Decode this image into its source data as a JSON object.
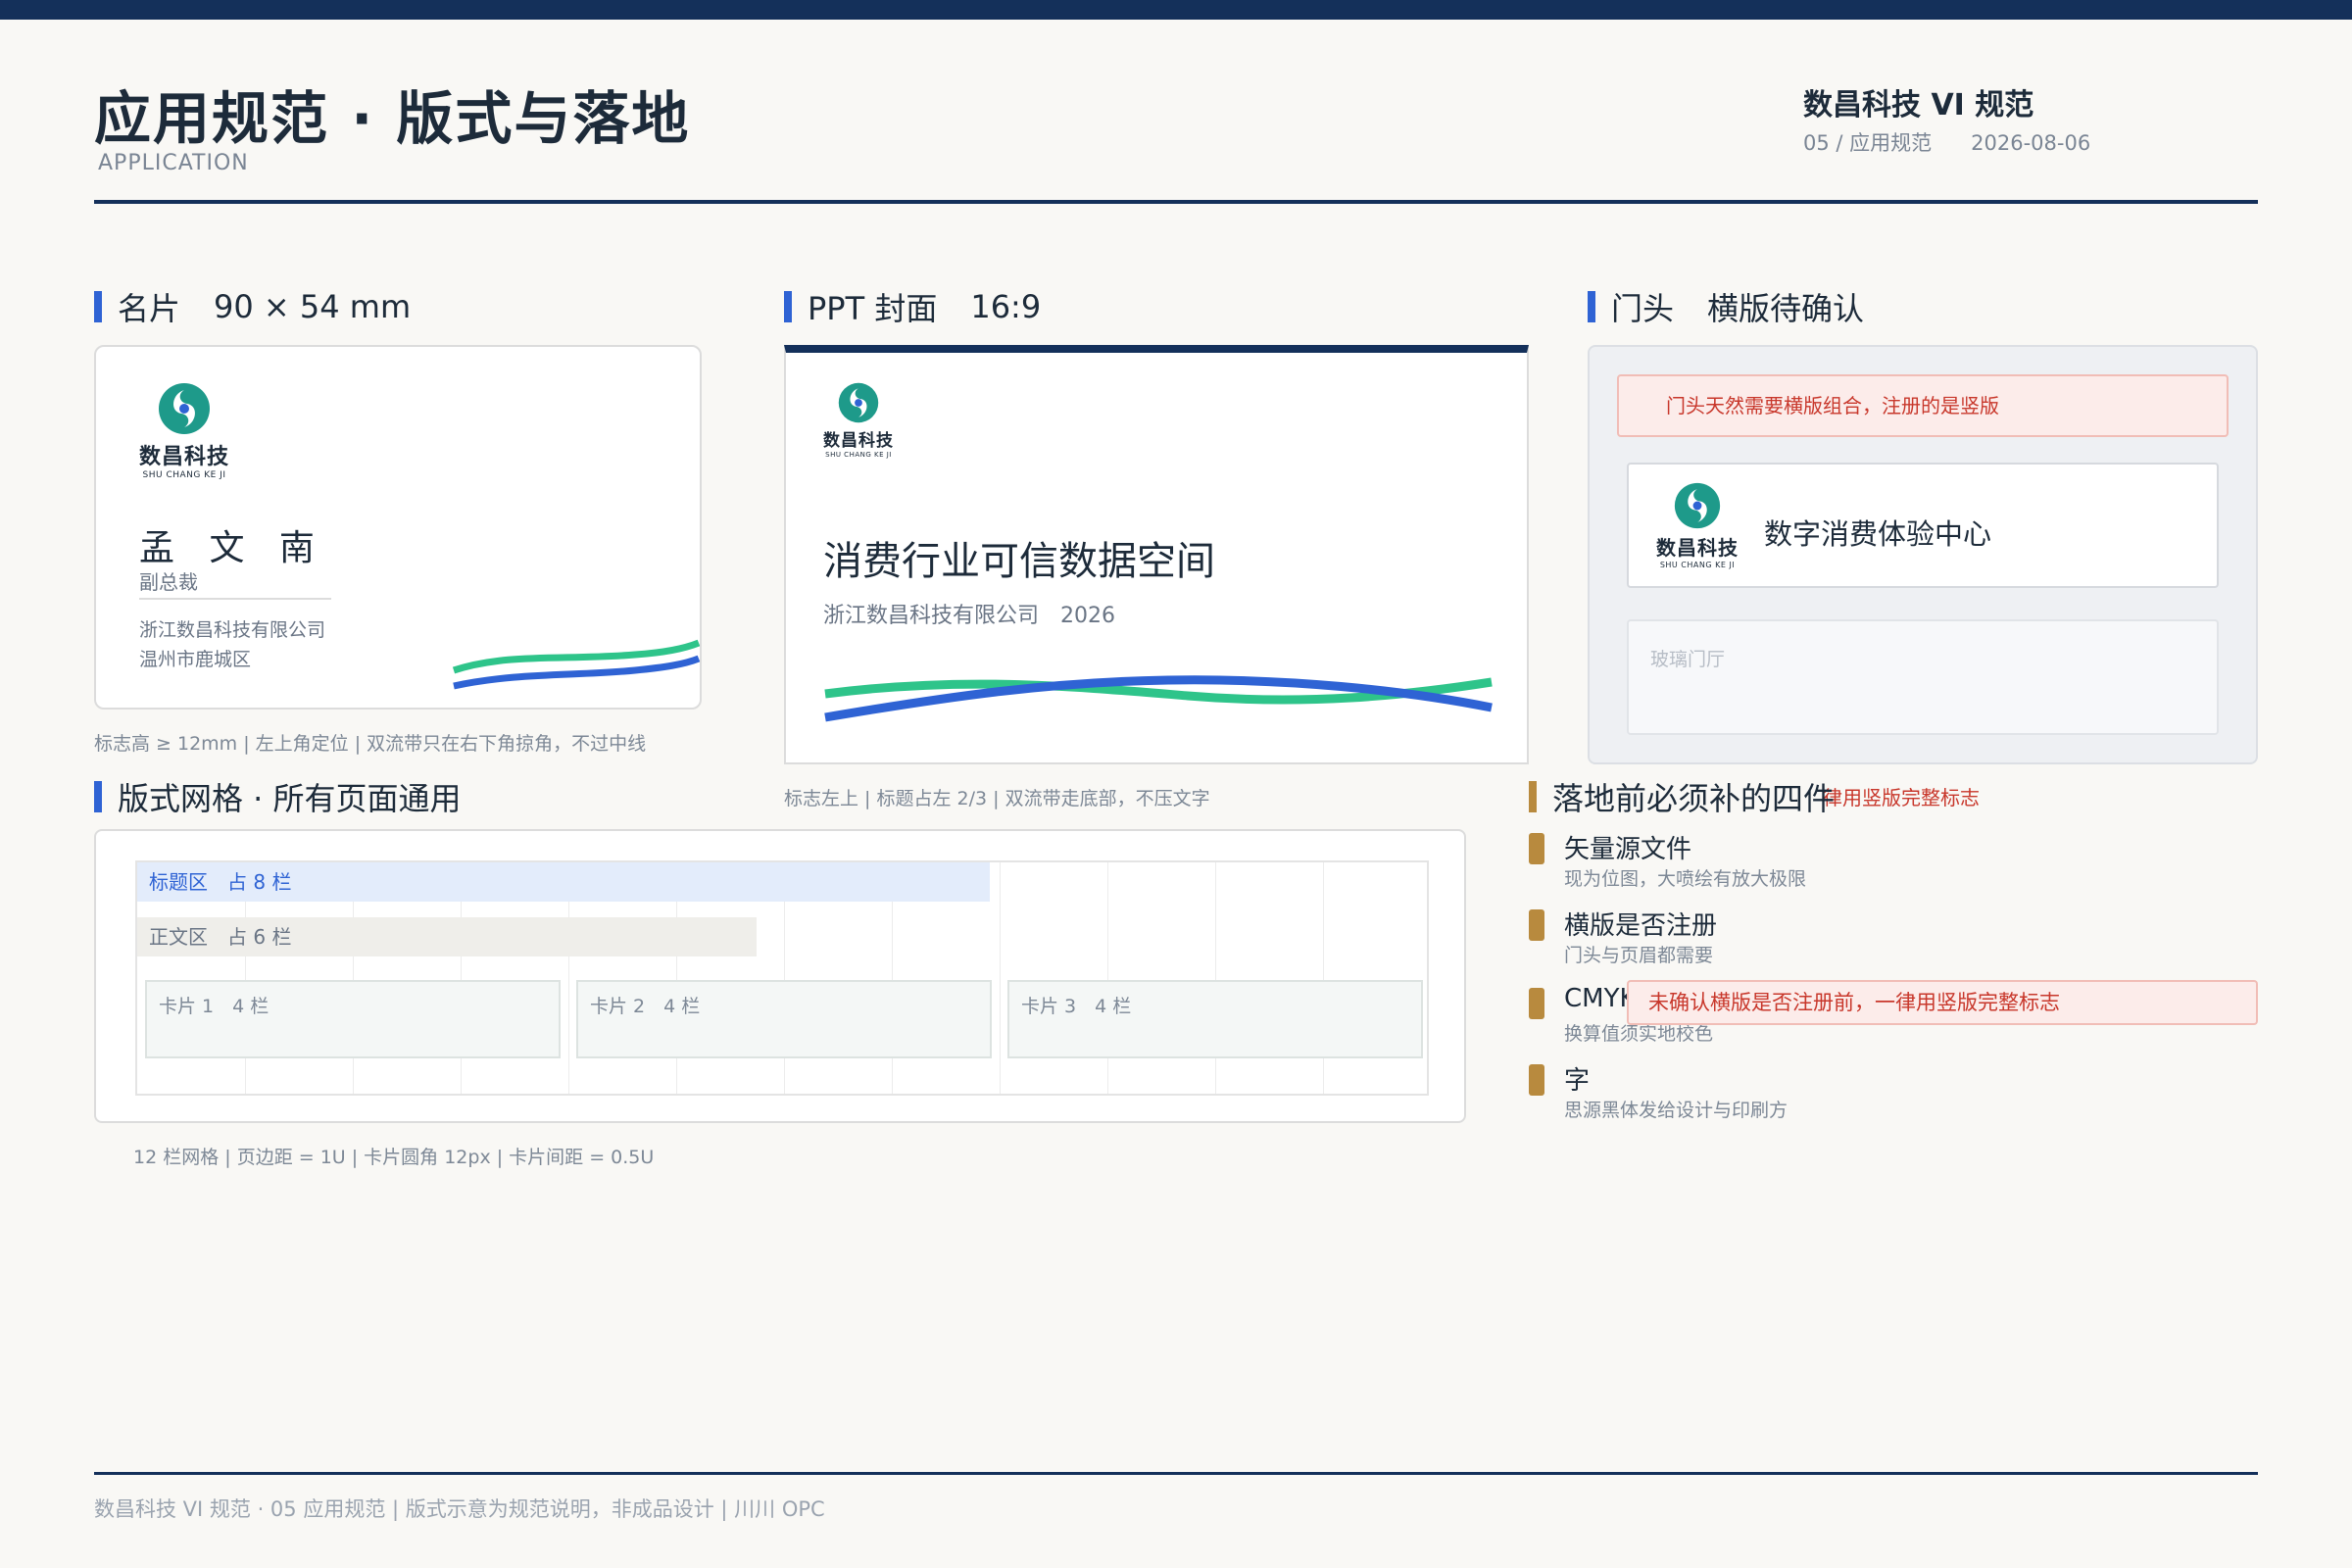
{
  "header": {
    "title": "应用规范 · 版式与落地",
    "subtitle": "APPLICATION",
    "brand": "数昌科技 VI 规范",
    "section": "05 / 应用规范",
    "date": "2026-08-06"
  },
  "logo": {
    "cn": "数昌科技",
    "en": "SHU CHANG KE JI"
  },
  "colors": {
    "navy": "#14305a",
    "accent_blue": "#2f63d4",
    "accent_green": "#2ec48a",
    "gold": "#b88a3e",
    "alert_red": "#c8372b"
  },
  "business_card": {
    "heading": "名片",
    "size": "90 × 54 mm",
    "name": "孟 文 南",
    "role": "副总裁",
    "company": "浙江数昌科技有限公司",
    "address": "温州市鹿城区",
    "caption": "标志高 ≥ 12mm  |  左上角定位  |  双流带只在右下角掠角，不过中线"
  },
  "ppt_cover": {
    "heading": "PPT 封面",
    "ratio": "16:9",
    "title": "消费行业可信数据空间",
    "subtitle": "浙江数昌科技有限公司　2026",
    "caption": "标志左上  |  标题占左 2/3  |  双流带走底部，不压文字"
  },
  "storefront": {
    "heading": "门头",
    "status": "横版待确认",
    "alert": "门头天然需要横版组合，注册的是竖版",
    "sign_text": "数字消费体验中心",
    "glass_label": "玻璃门厅"
  },
  "grid": {
    "heading": "版式网格 · 所有页面通用",
    "title_zone": "标题区　占 8 栏",
    "body_zone": "正文区　占 6 栏",
    "cards": [
      "卡片 1　4 栏",
      "卡片 2　4 栏",
      "卡片 3　4 栏"
    ],
    "caption": "12 栏网格  |  页边距 = 1U  |  卡片圆角 12px  |  卡片间距 = 0.5U"
  },
  "checklist": {
    "heading": "落地前必须补的四件",
    "ghost_alert": "律用竖版完整标志",
    "items": [
      {
        "title": "矢量源文件",
        "desc": "现为位图，大喷绘有放大极限"
      },
      {
        "title": "横版是否注册",
        "desc": "门头与页眉都需要"
      },
      {
        "title": "CMYK",
        "desc": "换算值须实地校色"
      },
      {
        "title": "字",
        "desc": "思源黑体发给设计与印刷方"
      }
    ],
    "alert": "未确认横版是否注册前，一律用竖版完整标志"
  },
  "footer": {
    "text": "数昌科技 VI 规范 · 05 应用规范  |  版式示意为规范说明，非成品设计  |  川川 OPC"
  }
}
